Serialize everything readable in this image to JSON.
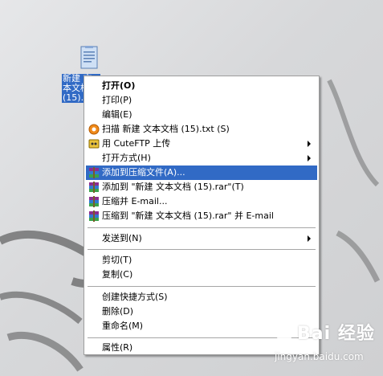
{
  "desktop": {
    "file_label": "新建 文本文档 (15).txt",
    "file_icon": "text-file-icon"
  },
  "menu": {
    "items": [
      {
        "label": "打开(O)",
        "bold": true
      },
      {
        "label": "打印(P)"
      },
      {
        "label": "编辑(E)"
      },
      {
        "label": "扫描 新建 文本文档 (15).txt (S)",
        "icon": "antivirus-scan-icon"
      },
      {
        "label": "用 CuteFTP 上传",
        "icon": "cuteftp-icon",
        "submenu": true
      },
      {
        "label": "打开方式(H)",
        "submenu": true
      },
      {
        "label": "添加到压缩文件(A)...",
        "icon": "winrar-icon",
        "highlighted": true
      },
      {
        "label": "添加到 \"新建 文本文档 (15).rar\"(T)",
        "icon": "winrar-icon"
      },
      {
        "label": "压缩并 E-mail...",
        "icon": "winrar-icon"
      },
      {
        "label": "压缩到 \"新建 文本文档 (15).rar\" 并 E-mail",
        "icon": "winrar-icon"
      },
      {
        "label": "发送到(N)",
        "submenu": true
      },
      {
        "label": "剪切(T)"
      },
      {
        "label": "复制(C)"
      },
      {
        "label": "创建快捷方式(S)"
      },
      {
        "label": "删除(D)"
      },
      {
        "label": "重命名(M)"
      },
      {
        "label": "属性(R)"
      }
    ],
    "highlight_color": "#316ac5"
  },
  "watermark": {
    "brand": "Bai 经验",
    "url": "jingyan.baidu.com"
  }
}
